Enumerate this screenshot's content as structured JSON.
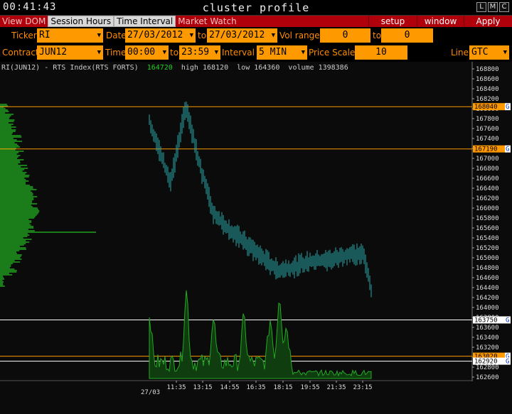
{
  "titlebar": {
    "clock": "00:41:43",
    "title": "cluster profile",
    "buttons": [
      "L",
      "M",
      "C"
    ]
  },
  "menu": {
    "left": [
      "View DOM",
      "Session Hours",
      "Time Interval",
      "Market Watch"
    ],
    "active": [
      "Session Hours",
      "Time Interval"
    ],
    "right": [
      "setup",
      "window",
      "Apply"
    ]
  },
  "controls": {
    "ticker_label": "Ticker",
    "ticker": "RI",
    "date_label": "Date",
    "date_from": "27/03/2012",
    "to_label": "to",
    "date_to": "27/03/2012",
    "volrange_label": "Vol range",
    "vol_from": "0",
    "vol_to_label": "to",
    "vol_to": "0",
    "contract_label": "Contract",
    "contract": "JUN12",
    "time_label": "Time",
    "time_from": "00:00",
    "time_to_label": "to",
    "time_to": "23:59",
    "interval_label": "Interval",
    "interval": "5 MIN",
    "pricescale_label": "Price Scale",
    "price_scale": "10",
    "line_label": "Line",
    "line": "GTC"
  },
  "chart": {
    "header_text": "RI(JUN12) - RTS Index(RTS FORTS)",
    "last": "164720",
    "high_text": "high 168120",
    "low_text": "low 164360",
    "volume_text": "volume 1398386"
  },
  "chart_data": {
    "type": "line",
    "y_axis_ticks": [
      "168800",
      "168600",
      "168400",
      "168200",
      "168000",
      "167800",
      "167600",
      "167400",
      "167200",
      "167000",
      "166800",
      "166600",
      "166400",
      "166200",
      "166000",
      "165800",
      "165600",
      "165400",
      "165200",
      "165000",
      "164800",
      "164600",
      "164400",
      "164200",
      "164000",
      "163800",
      "163600",
      "163400",
      "163200",
      "163000",
      "162800",
      "162600"
    ],
    "x_axis_ticks": [
      "11:35",
      "13:15",
      "14:55",
      "16:35",
      "18:15",
      "19:55",
      "21:35",
      "23:15"
    ],
    "x_date_label": "27/03",
    "price_levels": [
      {
        "value": "168040",
        "color": "#ff9900",
        "tag": "G"
      },
      {
        "value": "167190",
        "color": "#ff9900",
        "tag": "G"
      },
      {
        "value": "163750",
        "color": "#ffffff",
        "tag": "G"
      },
      {
        "value": "163020",
        "color": "#ff9900",
        "tag": "G"
      },
      {
        "value": "162920",
        "color": "#ffffff",
        "tag": "G"
      }
    ],
    "price_range": [
      162500,
      168900
    ],
    "price_series_color": "#2aa7a7",
    "volume_series_color": "#22aa22",
    "profile_color": "#1fa31f"
  }
}
